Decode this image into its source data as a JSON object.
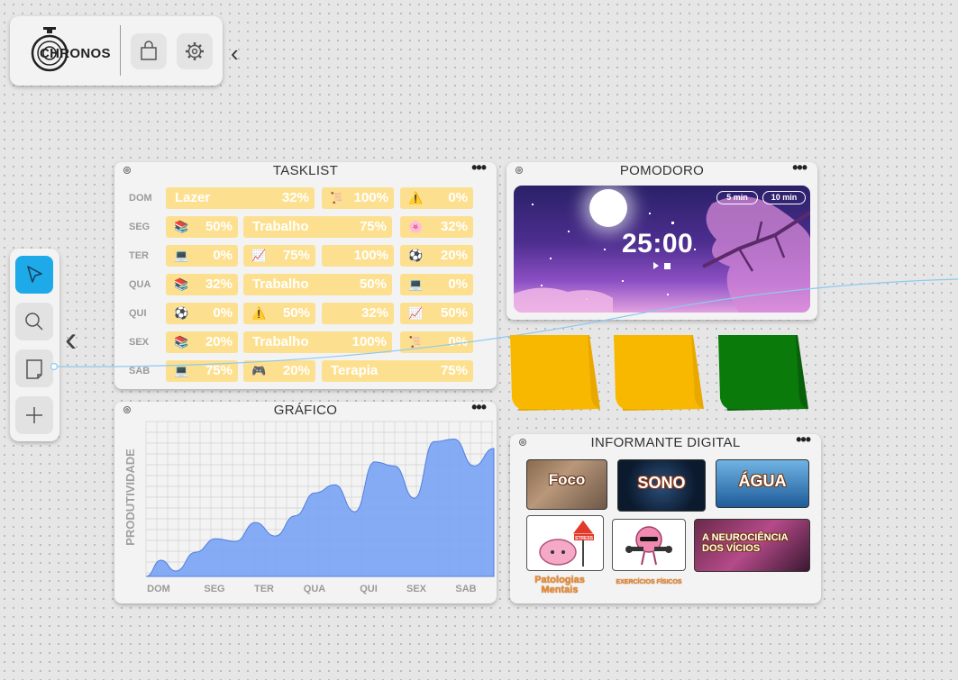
{
  "logo": {
    "text": "CHRONOS"
  },
  "top_icons": [
    "shopping-bag-icon",
    "gear-icon"
  ],
  "toolbar": {
    "tools": [
      "pointer-icon",
      "search-icon",
      "note-icon",
      "plus-icon"
    ],
    "active": "pointer-icon"
  },
  "tasklist": {
    "title": "TASKLIST",
    "menu": "•••",
    "days": [
      "DOM",
      "SEG",
      "TER",
      "QUA",
      "QUI",
      "SEX",
      "SAB"
    ],
    "rows": [
      [
        {
          "label": "Lazer",
          "pct": "32%"
        },
        {
          "icon": "scroll",
          "pct": "100%"
        },
        {
          "icon": "warning",
          "pct": "0%"
        }
      ],
      [
        {
          "icon": "books",
          "pct": "50%"
        },
        {
          "label": "Trabalho",
          "pct": "75%"
        },
        {
          "icon": "flower",
          "pct": "32%"
        }
      ],
      [
        {
          "icon": "laptop",
          "pct": "0%"
        },
        {
          "icon": "chart",
          "pct": "75%"
        },
        {
          "pct": "100%"
        },
        {
          "icon": "soccer",
          "pct": "20%"
        }
      ],
      [
        {
          "icon": "books",
          "pct": "32%"
        },
        {
          "label": "Trabalho",
          "pct": "50%"
        },
        {
          "icon": "laptop",
          "pct": "0%"
        }
      ],
      [
        {
          "icon": "soccer",
          "pct": "0%"
        },
        {
          "icon": "warning",
          "pct": "50%"
        },
        {
          "pct": "32%"
        },
        {
          "icon": "chart",
          "pct": "50%"
        }
      ],
      [
        {
          "icon": "books",
          "pct": "20%"
        },
        {
          "label": "Trabalho",
          "pct": "100%"
        },
        {
          "icon": "scroll",
          "pct": "0%"
        }
      ],
      [
        {
          "icon": "laptop",
          "pct": "75%"
        },
        {
          "icon": "gamepad",
          "pct": "20%"
        },
        {
          "label": "Terapia",
          "pct": "75%"
        }
      ]
    ]
  },
  "pomodoro": {
    "title": "POMODORO",
    "menu": "•••",
    "timer": "25:00",
    "options": [
      "5 min",
      "10 min"
    ]
  },
  "sticky_notes": {
    "colors": [
      "#f9b800",
      "#f9b800",
      "#0a7a0a"
    ]
  },
  "grafico": {
    "title": "GRÁFICO",
    "menu": "•••"
  },
  "chart_data": {
    "type": "area",
    "title": "GRÁFICO",
    "ylabel": "PRODUTIVIDADE",
    "xlabel": "",
    "categories": [
      "DOM",
      "SEG",
      "TER",
      "QUA",
      "QUI",
      "SEX",
      "SAB"
    ],
    "x": [
      0,
      0.3,
      0.6,
      1.0,
      1.4,
      1.8,
      2.2,
      2.6,
      3.0,
      3.4,
      3.8,
      4.2,
      4.6,
      5.0,
      5.4,
      5.8,
      6.2,
      6.6,
      7.0
    ],
    "values": [
      0,
      12,
      4,
      18,
      28,
      26,
      40,
      30,
      45,
      62,
      68,
      48,
      85,
      82,
      58,
      100,
      102,
      82,
      95
    ],
    "ylim": [
      0,
      115
    ],
    "grid": true,
    "color": "#7aa3f5"
  },
  "informante": {
    "title": "INFORMANTE DIGITAL",
    "menu": "•••",
    "cards": [
      {
        "title": "Foco"
      },
      {
        "title": "SONO"
      },
      {
        "title": "ÁGUA"
      },
      {
        "title": "",
        "caption": "Patologias Mentais",
        "sign": "STRESS"
      },
      {
        "title": "",
        "caption": "EXERCÍCIOS FÍSICOS"
      },
      {
        "title": "A   NEUROCIÊNCIA DOS VÍCIOS"
      }
    ]
  }
}
